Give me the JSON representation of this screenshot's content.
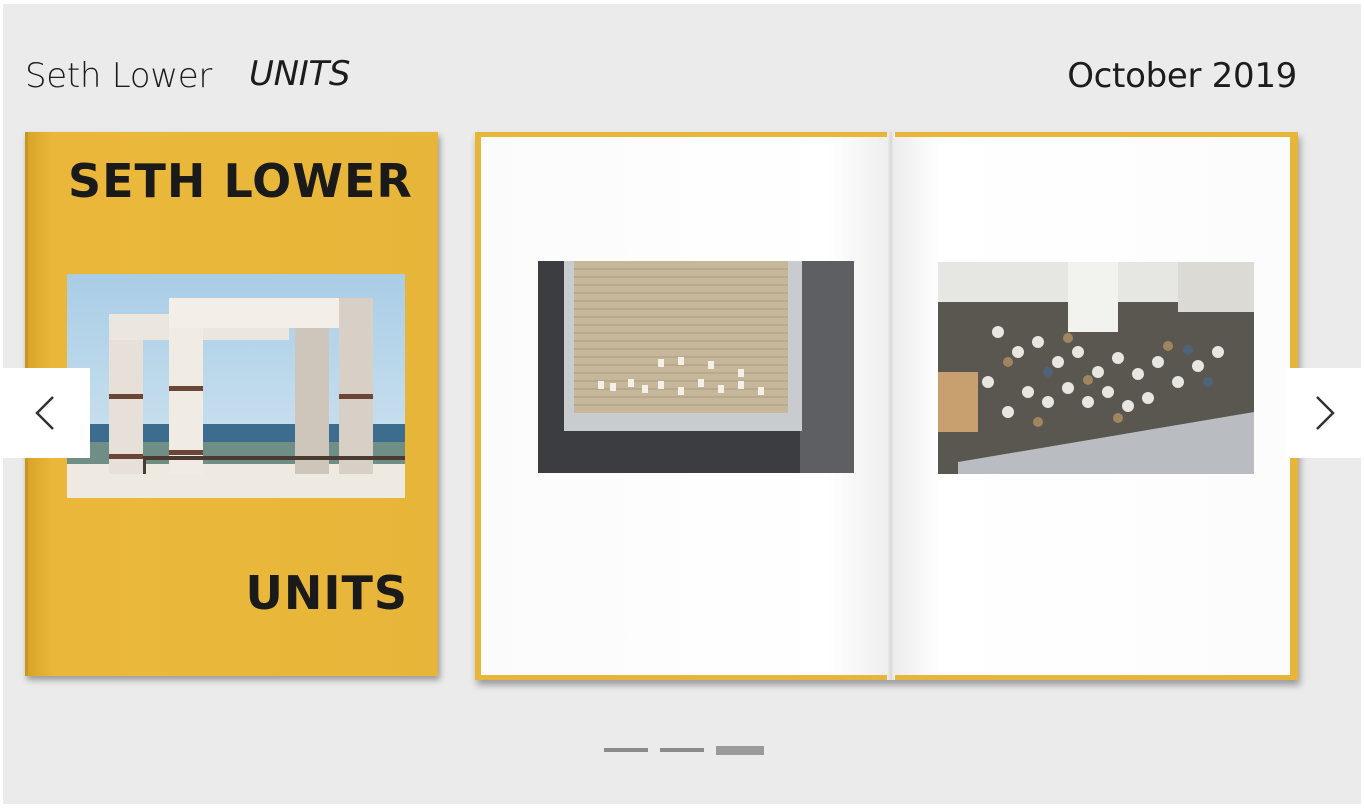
{
  "header": {
    "artist": "Seth Lower",
    "title": "UNITS",
    "date": "October 2019"
  },
  "cover": {
    "name": "SETH LOWER",
    "title": "UNITS",
    "color": "#e9b83b"
  },
  "spread": {
    "left_photo_icon": "shop-sign-photo",
    "right_photo_icon": "crowd-photo"
  },
  "navigation": {
    "prev_icon": "chevron-left-icon",
    "next_icon": "chevron-right-icon"
  },
  "pager": {
    "count": 3,
    "active_index": 2
  }
}
